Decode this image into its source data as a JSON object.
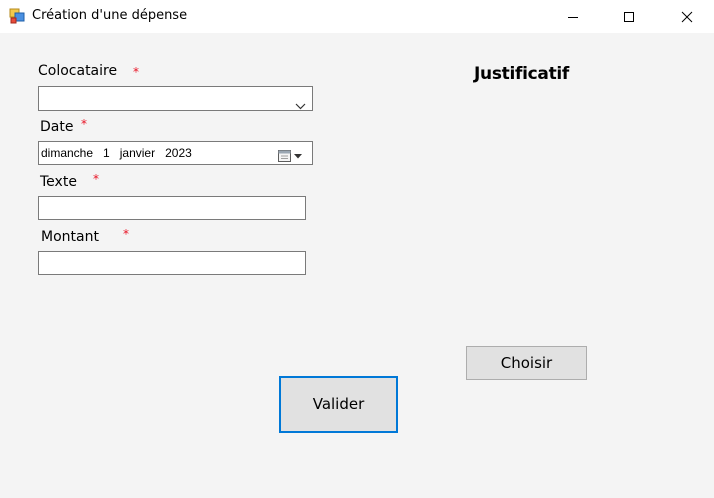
{
  "window": {
    "title": "Création d'une dépense",
    "icon": "windows-form-icon",
    "controls": [
      "minimize-icon",
      "maximize-icon",
      "close-icon"
    ]
  },
  "form": {
    "colocataire": {
      "label": "Colocataire",
      "required_marker": "*",
      "value": ""
    },
    "date": {
      "label": "Date",
      "required_marker": "*",
      "weekday": "dimanche",
      "day": "1",
      "month": "janvier",
      "year": "2023"
    },
    "texte": {
      "label": "Texte",
      "required_marker": "*",
      "value": ""
    },
    "montant": {
      "label": "Montant",
      "required_marker": "*",
      "value": ""
    }
  },
  "justificatif": {
    "heading": "Justificatif",
    "choose_label": "Choisir"
  },
  "actions": {
    "submit_label": "Valider"
  },
  "colors": {
    "required": "#e81123",
    "focus_border": "#0078d7",
    "button_bg": "#e1e1e1",
    "client_bg": "#f4f4f4"
  }
}
